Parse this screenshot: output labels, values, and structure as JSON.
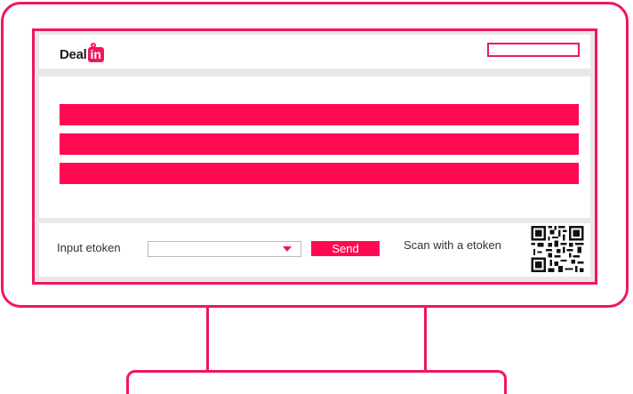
{
  "brand": {
    "logo_text": "Deal",
    "logo_accent": "in",
    "accent_color": "#f0175a",
    "bar_color": "#ff0a52"
  },
  "content": {
    "bars": [
      "",
      "",
      ""
    ]
  },
  "footer": {
    "input_label": "Input etoken",
    "select_value": "",
    "send_label": "Send",
    "scan_label": "Scan with a etoken",
    "qr_icon": "qr-code-icon"
  }
}
